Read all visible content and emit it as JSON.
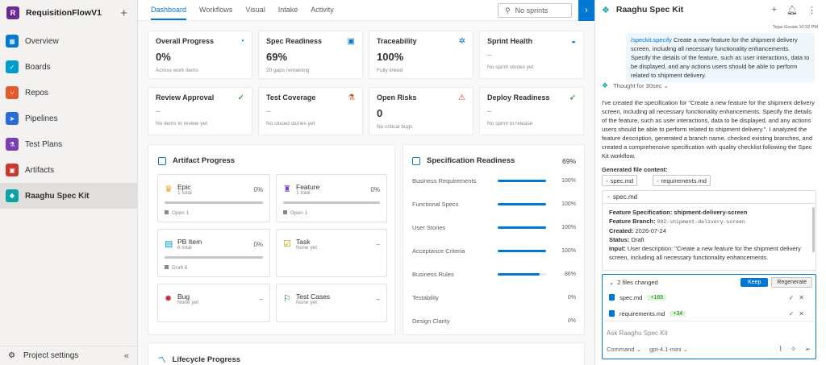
{
  "sidebar": {
    "org_initial": "R",
    "project_name": "RequisitionFlowV1",
    "add_symbol": "+",
    "items": [
      {
        "label": "Overview",
        "icon": "overview-icon",
        "color": "#0078d4"
      },
      {
        "label": "Boards",
        "icon": "boards-icon",
        "color": "#009ccc"
      },
      {
        "label": "Repos",
        "icon": "repos-icon",
        "color": "#e05a2b"
      },
      {
        "label": "Pipelines",
        "icon": "pipelines-icon",
        "color": "#2b6cd9"
      },
      {
        "label": "Test Plans",
        "icon": "test-plans-icon",
        "color": "#7a3fb5"
      },
      {
        "label": "Artifacts",
        "icon": "artifacts-icon",
        "color": "#c8392b"
      },
      {
        "label": "Raaghu Spec Kit",
        "icon": "spec-kit-icon",
        "color": "#0aa3a3"
      }
    ],
    "footer_label": "Project settings",
    "collapse_symbol": "«"
  },
  "main": {
    "tabs": [
      "Dashboard",
      "Workflows",
      "Visual",
      "Intake",
      "Activity"
    ],
    "sprint_select": "No sprints",
    "cards": [
      {
        "title": "Overall Progress",
        "value": "0%",
        "sub": "Across work items",
        "icon": "◔",
        "color": "#0078d4"
      },
      {
        "title": "Spec Readiness",
        "value": "69%",
        "sub": "20 gaps remaining",
        "icon": "▣",
        "color": "#0078d4"
      },
      {
        "title": "Traceability",
        "value": "100%",
        "sub": "Fully linked",
        "icon": "✲",
        "color": "#0078d4"
      },
      {
        "title": "Sprint Health",
        "value": "–",
        "sub": "No sprint stories yet",
        "icon": "◒",
        "color": "#0078d4"
      },
      {
        "title": "Review Approval",
        "value": "–",
        "sub": "No items to review yet",
        "icon": "✓",
        "color": "#107c10"
      },
      {
        "title": "Test Coverage",
        "value": "–",
        "sub": "No closed stories yet",
        "icon": "⚗",
        "color": "#ca5010"
      },
      {
        "title": "Open Risks",
        "value": "0",
        "sub": "No critical bugs",
        "icon": "⚠",
        "color": "#d13438"
      },
      {
        "title": "Deploy Readiness",
        "value": "–",
        "sub": "No sprint to release",
        "icon": "🚀",
        "color": "#107c10"
      }
    ],
    "artifact_progress": {
      "title": "Artifact Progress",
      "items": [
        {
          "name": "Epic",
          "sub": "1 total",
          "pct": "0%",
          "foot": "Open 1",
          "icon": "♛",
          "color": "#e8a317"
        },
        {
          "name": "Feature",
          "sub": "1 total",
          "pct": "0%",
          "foot": "Open 1",
          "icon": "♜",
          "color": "#773adc"
        },
        {
          "name": "PB Item",
          "sub": "6 total",
          "pct": "0%",
          "foot": "Draft 6",
          "icon": "▤",
          "color": "#009ccc"
        },
        {
          "name": "Task",
          "sub": "None yet",
          "pct": "–",
          "foot": "",
          "icon": "☑",
          "color": "#b5a000"
        },
        {
          "name": "Bug",
          "sub": "None yet",
          "pct": "–",
          "foot": "",
          "icon": "✹",
          "color": "#cc293d"
        },
        {
          "name": "Test Cases",
          "sub": "None yet",
          "pct": "–",
          "foot": "",
          "icon": "⚐",
          "color": "#107c10"
        }
      ]
    },
    "spec_readiness": {
      "title": "Specification Readiness",
      "total": "69%",
      "rows": [
        {
          "label": "Business Requirements",
          "pct": "100%",
          "value": 100
        },
        {
          "label": "Functional Specs",
          "pct": "100%",
          "value": 100
        },
        {
          "label": "User Stories",
          "pct": "100%",
          "value": 100
        },
        {
          "label": "Acceptance Criteria",
          "pct": "100%",
          "value": 100
        },
        {
          "label": "Business Rules",
          "pct": "86%",
          "value": 86
        },
        {
          "label": "Testability",
          "pct": "0%",
          "value": 0
        },
        {
          "label": "Design Clarity",
          "pct": "0%",
          "value": 0
        }
      ]
    },
    "lifecycle": {
      "title": "Lifecycle Progress"
    }
  },
  "chat": {
    "title": "Raaghu Spec Kit",
    "meta": "Tejas Gorate  10:32 PM",
    "user_command": "/speckit.specify",
    "user_text": " Create a new feature for the shipment delivery screen, including all necessary functionality enhancements. Specify the details of the feature, such as user interactions, data to be displayed, and any actions users should be able to perform related to shipment delivery.",
    "thinking": "Thought for 30sec",
    "assistant_text": "I've created the specification for \"Create a new feature for the shipment delivery screen, including all necessary functionality enhancements. Specify the details of the feature, such as user interactions, data to be displayed, and any actions users should be able to perform related to shipment delivery.\". I analyzed the feature description, generated a branch name, checked existing branches, and created a comprehensive specification with quality checklist following the Spec Kit workflow.",
    "generated_label": "Generated file content:",
    "chips": [
      "spec.md",
      "requirements.md"
    ],
    "preview": {
      "file": "spec.md",
      "lines": [
        {
          "k": "Feature Specification: shipment-delivery-screen",
          "v": ""
        },
        {
          "k": "Feature Branch: ",
          "v": "002-shipment-delivery-screen"
        },
        {
          "k": "Created: ",
          "v": "2026-07-24"
        },
        {
          "k": "Status: ",
          "v": "Draft"
        },
        {
          "k": "Input: ",
          "v": "User description: \"Create a new feature for the shipment delivery screen, including all necessary functionality enhancements."
        }
      ]
    },
    "changes": {
      "label": "2 files changed",
      "keep": "Keep",
      "regenerate": "Regenerate",
      "files": [
        {
          "name": "spec.md",
          "added": "+165"
        },
        {
          "name": "requirements.md",
          "added": "+34"
        }
      ]
    },
    "input_placeholder": "Ask Raaghu Spec Kit",
    "mode": "Command",
    "model": "gpt-4.1-mini"
  }
}
